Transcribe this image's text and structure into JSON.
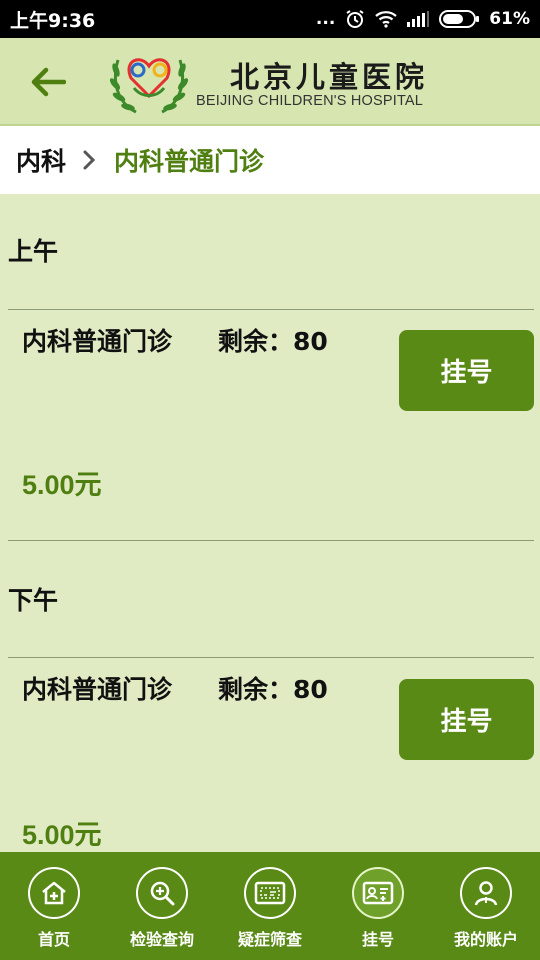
{
  "status_bar": {
    "time": "上午9:36",
    "signal_dots": "...",
    "battery_percent": "61%"
  },
  "header": {
    "logo_cn": "北京儿童医院",
    "logo_en": "BEIJING CHILDREN'S HOSPITAL"
  },
  "breadcrumb": {
    "parent": "内科",
    "current": "内科普通门诊"
  },
  "sessions": [
    {
      "period": "上午",
      "slot": {
        "name": "内科普通门诊",
        "remaining": "剩余：80",
        "price": "5.00元",
        "button": "挂号"
      }
    },
    {
      "period": "下午",
      "slot": {
        "name": "内科普通门诊",
        "remaining": "剩余：80",
        "price": "5.00元",
        "button": "挂号"
      }
    }
  ],
  "bottom_nav": [
    {
      "label": "首页",
      "icon": "home-icon"
    },
    {
      "label": "检验查询",
      "icon": "search-zoom-icon"
    },
    {
      "label": "疑症筛查",
      "icon": "screening-icon"
    },
    {
      "label": "挂号",
      "icon": "register-card-icon",
      "active": true
    },
    {
      "label": "我的账户",
      "icon": "user-icon"
    }
  ],
  "colors": {
    "brand_green": "#5a8a16",
    "accent_text_green": "#4f7f10",
    "page_bg": "#e0ebc4",
    "header_bg": "#d7e6b0"
  }
}
